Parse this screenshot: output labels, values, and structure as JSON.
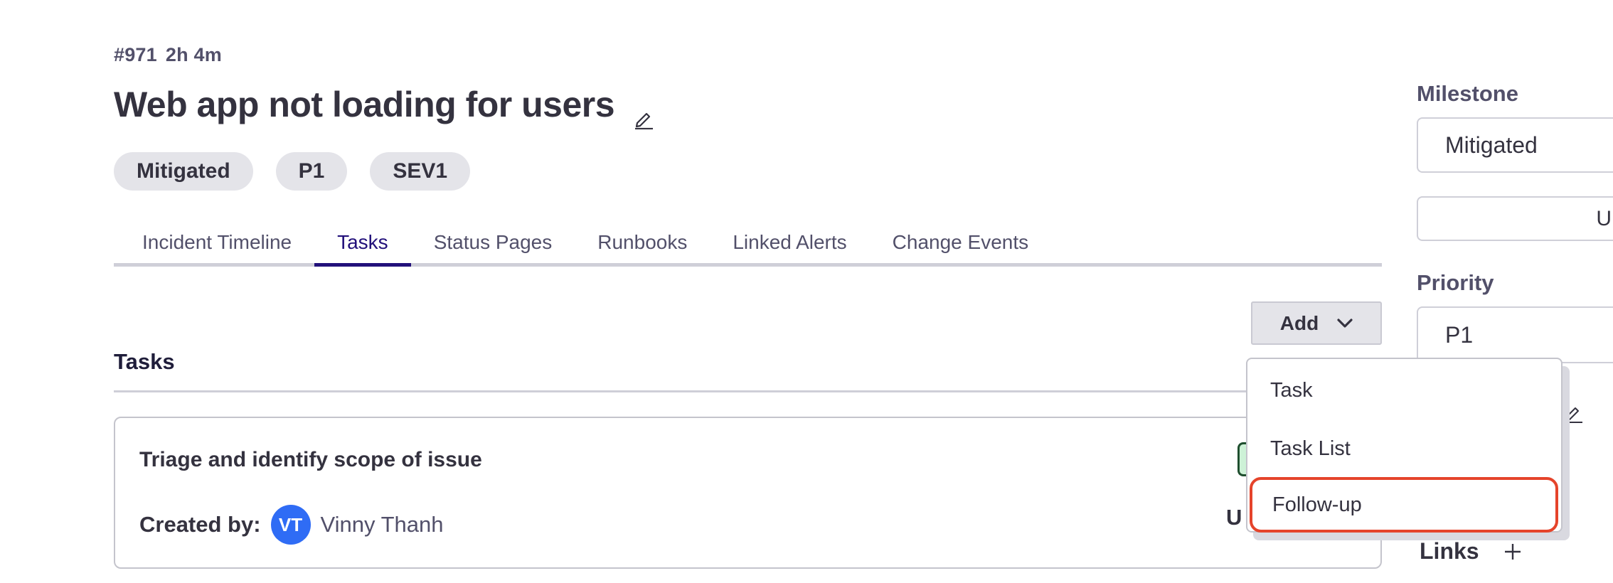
{
  "incident": {
    "number": "#971",
    "duration": "2h 4m",
    "title": "Web app not loading for users",
    "pills": [
      "Mitigated",
      "P1",
      "SEV1"
    ]
  },
  "tabs": [
    {
      "label": "Incident Timeline",
      "active": false
    },
    {
      "label": "Tasks",
      "active": true
    },
    {
      "label": "Status Pages",
      "active": false
    },
    {
      "label": "Runbooks",
      "active": false
    },
    {
      "label": "Linked Alerts",
      "active": false
    },
    {
      "label": "Change Events",
      "active": false
    }
  ],
  "tasks_section": {
    "title": "Tasks",
    "add_button_label": "Add",
    "dropdown": {
      "items": [
        "Task",
        "Task List",
        "Follow-up"
      ],
      "highlighted": "Follow-up"
    },
    "cards": [
      {
        "title": "Triage and identify scope of issue",
        "created_by_label": "Created by:",
        "creator_initials": "VT",
        "creator_name": "Vinny Thanh",
        "truncated_right_text": "U"
      }
    ]
  },
  "right_panel": {
    "milestone_label": "Milestone",
    "milestone_value": "Mitigated",
    "update_button_partial": "U",
    "priority_label": "Priority",
    "priority_value": "P1",
    "links_label": "Links"
  },
  "colors": {
    "accent": "#22107a",
    "avatar": "#2f6cf5",
    "highlight_outline": "#e5442b",
    "pill_bg": "#e4e4e9"
  }
}
